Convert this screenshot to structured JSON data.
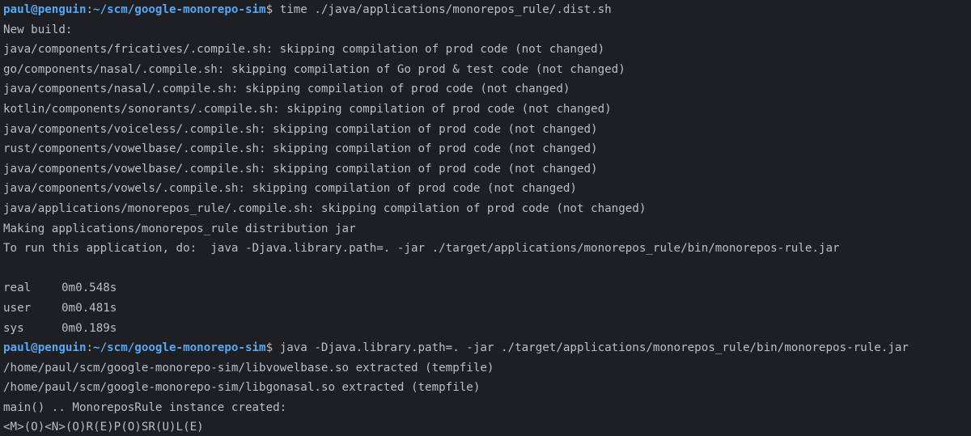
{
  "prompt": {
    "user_host": "paul@penguin",
    "separator": ":",
    "path": "~/scm/google-monorepo-sim",
    "symbol": "$"
  },
  "lines": [
    {
      "type": "prompt",
      "command": "time ./java/applications/monorepos_rule/.dist.sh"
    },
    {
      "type": "out",
      "text": "New build:"
    },
    {
      "type": "out",
      "text": "java/components/fricatives/.compile.sh: skipping compilation of prod code (not changed)"
    },
    {
      "type": "out",
      "text": "go/components/nasal/.compile.sh: skipping compilation of Go prod & test code (not changed)"
    },
    {
      "type": "out",
      "text": "java/components/nasal/.compile.sh: skipping compilation of prod code (not changed)"
    },
    {
      "type": "out",
      "text": "kotlin/components/sonorants/.compile.sh: skipping compilation of prod code (not changed)"
    },
    {
      "type": "out",
      "text": "java/components/voiceless/.compile.sh: skipping compilation of prod code (not changed)"
    },
    {
      "type": "out",
      "text": "rust/components/vowelbase/.compile.sh: skipping compilation of prod code (not changed)"
    },
    {
      "type": "out",
      "text": "java/components/vowelbase/.compile.sh: skipping compilation of prod code (not changed)"
    },
    {
      "type": "out",
      "text": "java/components/vowels/.compile.sh: skipping compilation of prod code (not changed)"
    },
    {
      "type": "out",
      "text": "java/applications/monorepos_rule/.compile.sh: skipping compilation of prod code (not changed)"
    },
    {
      "type": "out",
      "text": "Making applications/monorepos_rule distribution jar"
    },
    {
      "type": "out",
      "text": "To run this application, do:  java -Djava.library.path=. -jar ./target/applications/monorepos_rule/bin/monorepos-rule.jar"
    },
    {
      "type": "out",
      "text": ""
    },
    {
      "type": "time",
      "label": "real",
      "value": "0m0.548s"
    },
    {
      "type": "time",
      "label": "user",
      "value": "0m0.481s"
    },
    {
      "type": "time",
      "label": "sys",
      "value": "0m0.189s"
    },
    {
      "type": "prompt",
      "command": "java -Djava.library.path=. -jar ./target/applications/monorepos_rule/bin/monorepos-rule.jar"
    },
    {
      "type": "out",
      "text": "/home/paul/scm/google-monorepo-sim/libvowelbase.so extracted (tempfile)"
    },
    {
      "type": "out",
      "text": "/home/paul/scm/google-monorepo-sim/libgonasal.so extracted (tempfile)"
    },
    {
      "type": "out",
      "text": "main() .. MonoreposRule instance created:"
    },
    {
      "type": "out",
      "text": "<M>(O)<N>(O)R(E)P(O)SR(U)L(E)"
    }
  ]
}
